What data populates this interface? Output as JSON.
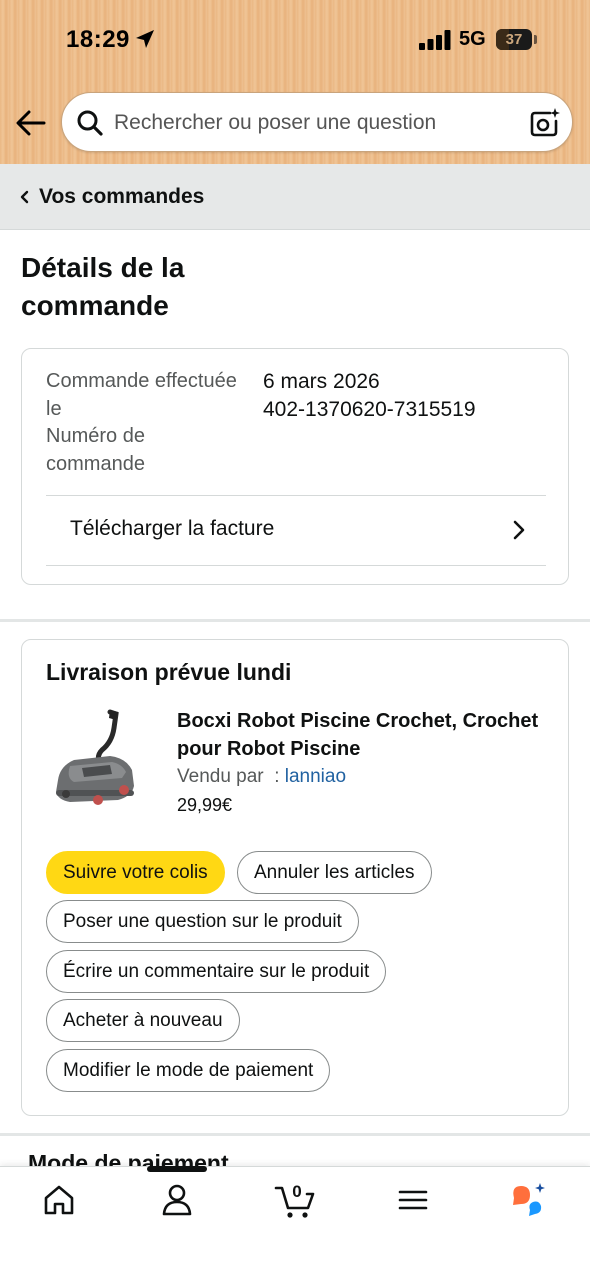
{
  "status_bar": {
    "time": "18:29",
    "network": "5G",
    "battery": "37",
    "battery_level": 0.37
  },
  "search": {
    "placeholder": "Rechercher ou poser une question"
  },
  "breadcrumb": {
    "label": "Vos commandes"
  },
  "page": {
    "title": "Détails de la commande"
  },
  "summary": {
    "labels": [
      "Commande effectuée le",
      "Numéro de commande"
    ],
    "date": "6 mars 2026",
    "order_number": "402-1370620-7315519",
    "invoice_label": "Télécharger la facture"
  },
  "delivery": {
    "title": "Livraison prévue lundi",
    "product": {
      "name": "Bocxi Robot Piscine Crochet, Crochet pour Robot Piscine",
      "seller_prefix": "Vendu par  : ",
      "seller": "lanniao",
      "price": "29,99€"
    },
    "buttons": {
      "track": "Suivre votre colis",
      "cancel": "Annuler les articles",
      "question": "Poser une question sur le produit",
      "review": "Écrire un commentaire sur le produit",
      "buy_again": "Acheter à nouveau",
      "payment": "Modifier le mode de paiement"
    }
  },
  "next_section": {
    "title": "Mode de paiement"
  },
  "bottom_nav": {
    "cart_count": "0",
    "items": [
      "home-icon",
      "account-icon",
      "cart-icon",
      "menu-icon",
      "assistant-icon"
    ]
  },
  "colors": {
    "header": "#eab884",
    "accent_button": "#ffd814",
    "link": "#2162a1"
  }
}
